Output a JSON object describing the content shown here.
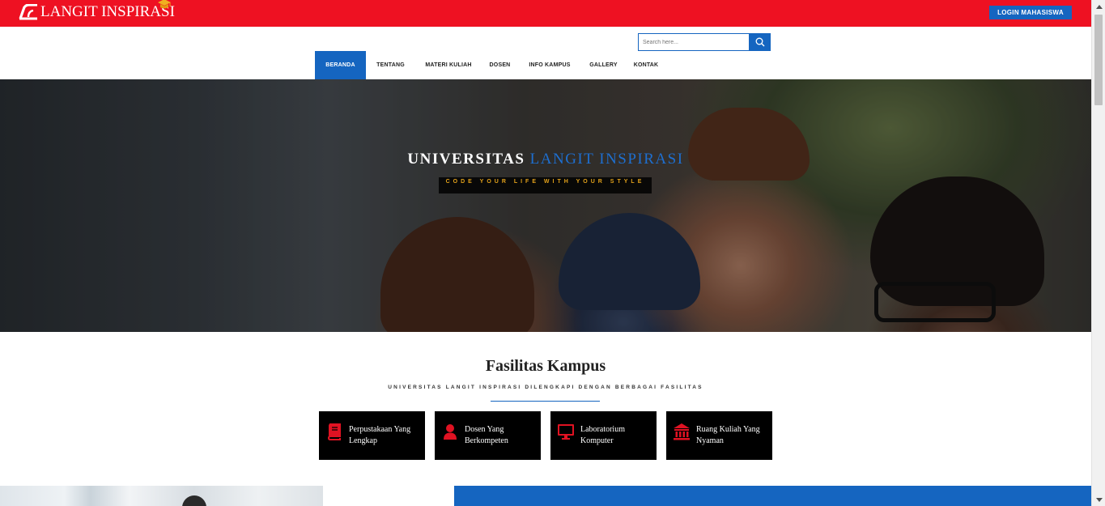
{
  "header": {
    "logo_text": "LANGIT INSPIRASI",
    "login_label": "LOGIN MAHASISWA",
    "brand_red": "#ee1122",
    "accent_blue": "#1565c0"
  },
  "search": {
    "placeholder": "Search here..."
  },
  "nav": {
    "items": [
      {
        "label": "BERANDA",
        "active": true
      },
      {
        "label": "TENTANG"
      },
      {
        "label": "MATERI KULIAH"
      },
      {
        "label": "DOSEN"
      },
      {
        "label": "INFO KAMPUS"
      },
      {
        "label": "GALLERY"
      },
      {
        "label": "KONTAK"
      }
    ]
  },
  "hero": {
    "title_main": "UNIVERSITAS",
    "title_accent": "LANGIT INSPIRASI",
    "tagline": "CODE YOUR LIFE WITH YOUR STYLE"
  },
  "facilities": {
    "title": "Fasilitas Kampus",
    "subtitle": "UNIVERSITAS LANGIT INSPIRASI DILENGKAPI DENGAN BERBAGAI FASILITAS",
    "items": [
      {
        "label": "Perpustakaan Yang Lengkap",
        "icon": "book-icon"
      },
      {
        "label": "Dosen Yang Berkompeten",
        "icon": "user-icon"
      },
      {
        "label": "Laboratorium Komputer",
        "icon": "monitor-icon"
      },
      {
        "label": "Ruang Kuliah Yang Nyaman",
        "icon": "building-icon"
      }
    ]
  }
}
